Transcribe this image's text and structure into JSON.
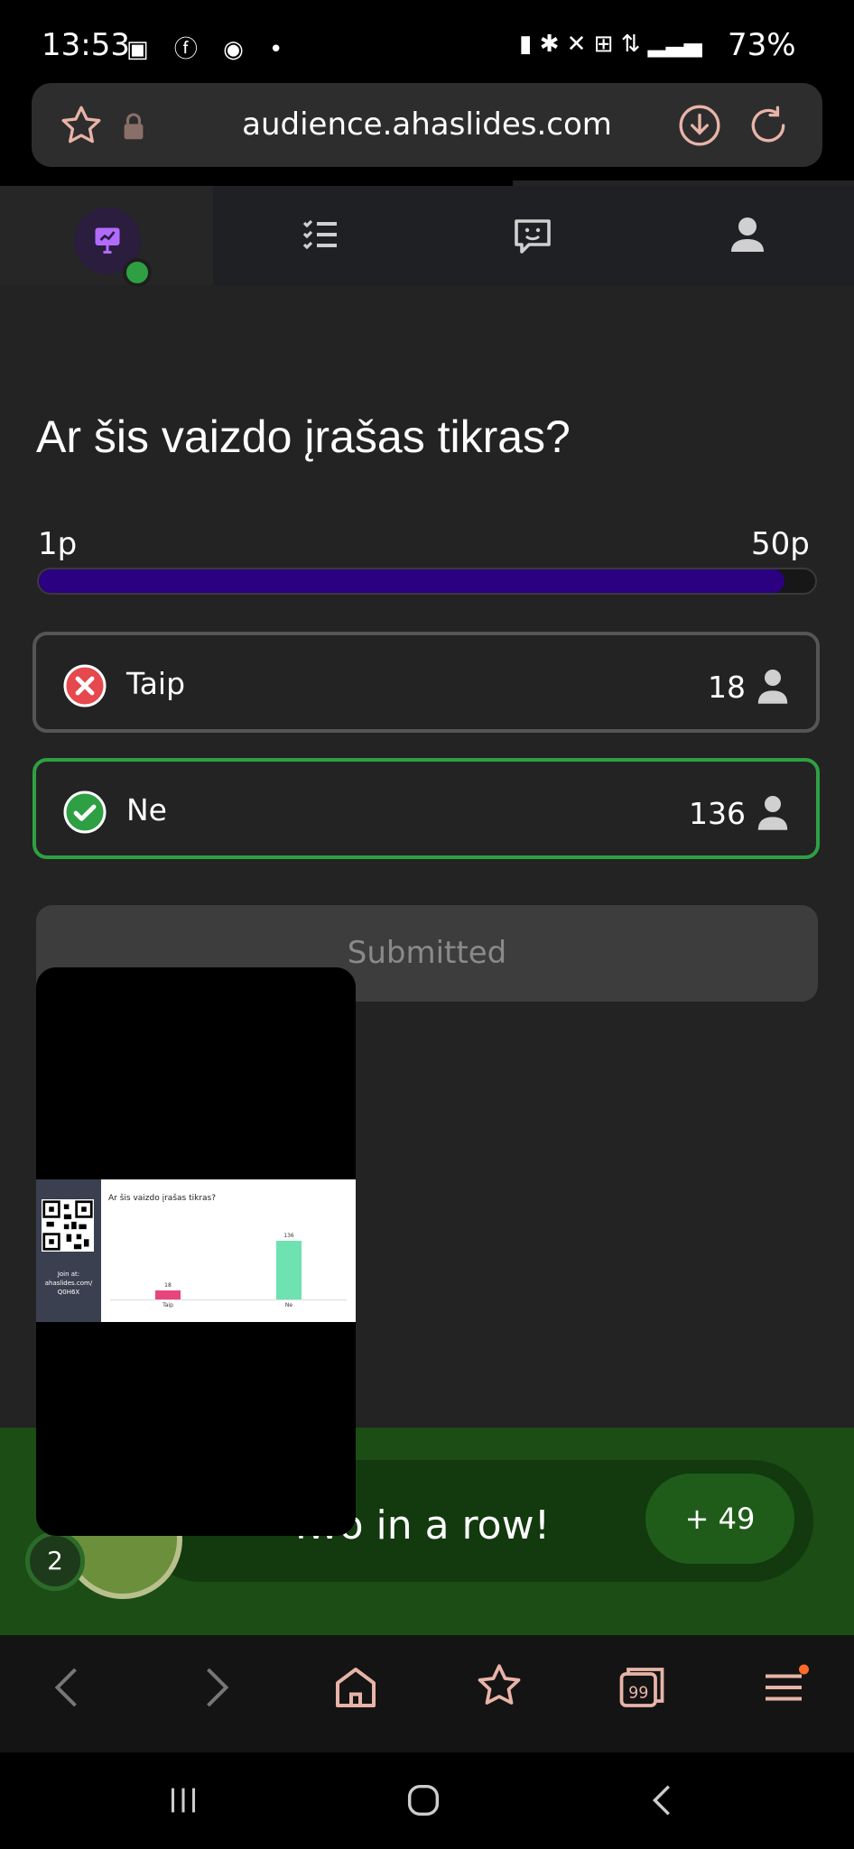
{
  "status_bar": {
    "time": "13:53",
    "battery": "73%"
  },
  "browser": {
    "url": "audience.ahaslides.com"
  },
  "question": {
    "title": "Ar šis vaizdo įrašas tikras?",
    "scale_min": "1p",
    "scale_max": "50p",
    "points_fill_fraction": 0.96
  },
  "options": [
    {
      "label": "Taip",
      "count": "18",
      "status": "incorrect"
    },
    {
      "label": "Ne",
      "count": "136",
      "status": "correct"
    }
  ],
  "submit": {
    "label": "Submitted"
  },
  "streak": {
    "text": "Two in a row!",
    "points": "+ 49",
    "count": "2"
  },
  "video_overlay": {
    "slide_title": "Ar šis vaizdo įrašas tikras?",
    "join_text": "Join at: ahaslides.com/ Q0H6X",
    "bars": [
      {
        "label": "Taip",
        "value": 18
      },
      {
        "label": "Ne",
        "value": 136
      }
    ]
  },
  "colors": {
    "accent_purple": "#2b0081",
    "correct_green": "#2ea043",
    "incorrect_red": "#e5484d"
  }
}
